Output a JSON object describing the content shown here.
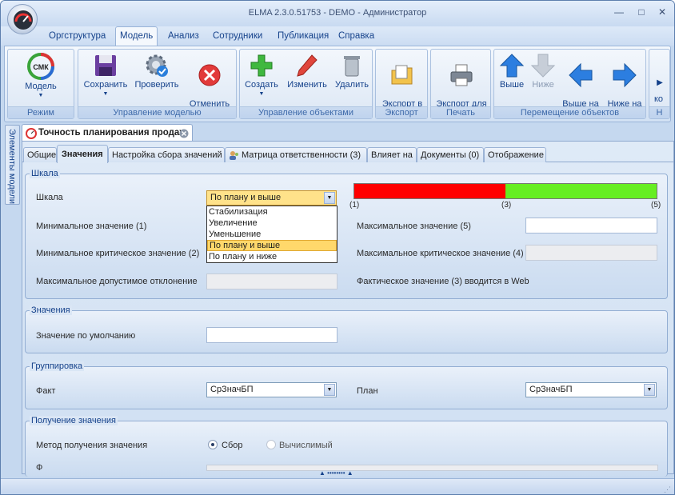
{
  "window": {
    "title": "ELMA 2.3.0.51753 - DEMO - Администратор",
    "minimize": "—",
    "maximize": "□",
    "close": "✕"
  },
  "menu": [
    "Оргструктура",
    "Модель",
    "Анализ",
    "Сотрудники",
    "Публикация",
    "Справка"
  ],
  "ribbon": {
    "groups": {
      "mode": "Режим",
      "model_mgmt": "Управление моделью",
      "objects_mgmt": "Управление объектами",
      "export": "Экспорт",
      "print": "Печать",
      "move": "Перемещение объектов",
      "cut": "Н"
    },
    "buttons": {
      "model": "Модель",
      "save": "Сохранить",
      "check": "Проверить",
      "cancel": "Отменить\nизменения",
      "create": "Создать",
      "edit": "Изменить",
      "delete": "Удалить",
      "export_html": "Экспорт в\nHTML",
      "export_print": "Экспорт для\nпечати",
      "up": "Выше",
      "down": "Ниже",
      "upper_level": "Выше на\nуровень",
      "lower_level": "Ниже на\nуровень",
      "more": "ко"
    },
    "smk": "СМК"
  },
  "side_tab": "Элементы модели",
  "doc_tab": "Точность планирования продаж",
  "tabs": [
    "Общие",
    "Значения",
    "Настройка сбора значений",
    "Матрица ответственности (3)",
    "Влияет на",
    "Документы (0)",
    "Отображение"
  ],
  "scale": {
    "section": "Шкала",
    "scale_label": "Шкала",
    "scale_value": "По плану и выше",
    "min_label": "Минимальное значение (1)",
    "min_crit_label": "Минимальное критическое значение (2)",
    "max_dev_label": "Максимальное допустимое отклонение",
    "max_label": "Максимальное значение (5)",
    "max_crit_label": "Максимальное критическое значение (4)",
    "actual_note": "Фактическое значение (3) вводится в Web",
    "bar_labels": [
      "(1)",
      "(3)",
      "(5)"
    ],
    "bar_red_fraction": 0.5,
    "red": "#ff0000",
    "green": "#66ee22",
    "options": [
      "Стабилизация",
      "Увеличение",
      "Уменьшение",
      "По плану и выше",
      "По плану и ниже"
    ],
    "selected_option": "По плану и выше"
  },
  "values": {
    "section": "Значения",
    "default_label": "Значение по умолчанию"
  },
  "grouping": {
    "section": "Группировка",
    "fact_label": "Факт",
    "fact_value": "СрЗначБП",
    "plan_label": "План",
    "plan_value": "СрЗначБП"
  },
  "obtain": {
    "section": "Получение значения",
    "method_label": "Метод получения значения",
    "opt_collect": "Сбор",
    "opt_calc": "Вычислимый",
    "selected": "Сбор",
    "next_label": "Ф"
  }
}
